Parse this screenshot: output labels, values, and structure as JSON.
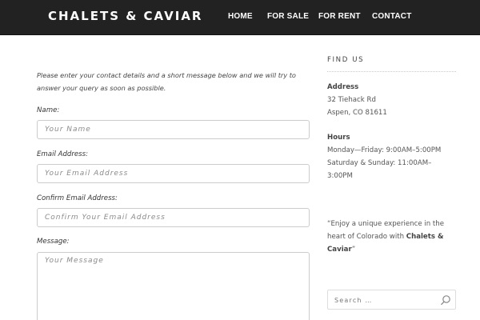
{
  "header": {
    "logo": "CHALETS & CAVIAR",
    "nav": [
      {
        "label": "HOME"
      },
      {
        "label": "FOR SALE"
      },
      {
        "label": "FOR RENT"
      },
      {
        "label": "CONTACT"
      }
    ]
  },
  "form": {
    "intro": "Please enter your contact details and a short message below and we will try to answer your query as soon as possible.",
    "name": {
      "label": "Name:",
      "placeholder": "Your Name"
    },
    "email": {
      "label": "Email Address:",
      "placeholder": "Your Email Address"
    },
    "confirm_email": {
      "label": "Confirm Email Address:",
      "placeholder": "Confirm Your Email Address"
    },
    "message": {
      "label": "Message:",
      "placeholder": "Your Message"
    }
  },
  "sidebar": {
    "title": "FIND US",
    "address": {
      "heading": "Address",
      "line1": "32 Tiehack Rd",
      "line2": "Aspen, CO 81611"
    },
    "hours": {
      "heading": "Hours",
      "line1": "Monday—Friday: 9:00AM–5:00PM",
      "line2": "Saturday & Sunday: 11:00AM–",
      "line3": "3:00PM"
    },
    "quote": {
      "prefix": "“Enjoy a unique experience in the heart of Colorado with ",
      "brand": "Chalets & Caviar",
      "suffix": "”"
    },
    "search": {
      "placeholder": "Search …",
      "icon": "search-icon"
    }
  },
  "colors": {
    "header_bg": "#222222",
    "header_text": "#ffffff",
    "body_text": "#444444",
    "field_border": "#cccccc"
  }
}
